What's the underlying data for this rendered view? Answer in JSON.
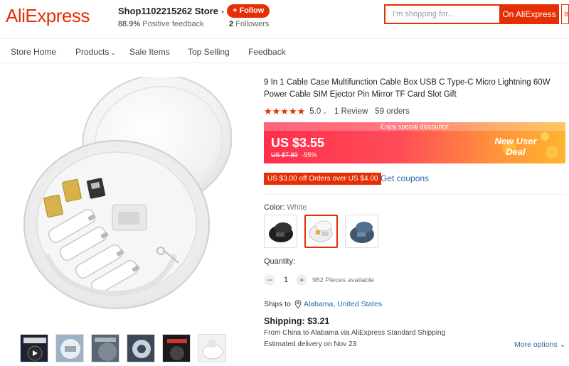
{
  "header": {
    "logo": "AliExpress",
    "store_name": "Shop1102215262 Store",
    "store_caret": "▾",
    "feedback_pct": "88.9%",
    "feedback_label": "Positive feedback",
    "follow_label": "+ Follow",
    "followers_count": "2",
    "followers_label": "Followers",
    "search_placeholder": "I'm shopping for...",
    "search_button": "On AliExpress",
    "search_right": "In"
  },
  "nav": {
    "items": [
      {
        "label": "Store Home"
      },
      {
        "label": "Products",
        "caret": "⌄"
      },
      {
        "label": "Sale Items"
      },
      {
        "label": "Top Selling"
      },
      {
        "label": "Feedback"
      }
    ]
  },
  "product": {
    "title": "9 In 1 Cable Case Multifunction Cable Box USB C Type-C Micro Lightning 60W Power Cable SIM Ejector Pin Mirror TF Card Slot Gift",
    "stars": "★★★★★",
    "rating": "5.0",
    "rating_caret": "⌄",
    "reviews": "1 Review",
    "orders": "59 orders"
  },
  "price": {
    "banner_text": "Enjoy special discounts!",
    "current": "US $3.55",
    "original": "US $7.89",
    "discount": "-55%",
    "new_user": "New User Deal",
    "coupon_tag": "US $3.00 off Orders over US $4.00",
    "coupon_link": "Get coupons"
  },
  "color": {
    "label": "Color:",
    "selected": "White",
    "options": [
      "Black",
      "White",
      "Blue"
    ],
    "selected_index": 1
  },
  "quantity": {
    "label": "Quantity:",
    "minus": "−",
    "plus": "+",
    "value": "1",
    "available": "982 Pieces available"
  },
  "shipping": {
    "ships_to_label": "Ships to",
    "ships_to_location": "Alabama, United States",
    "title": "Shipping: $3.21",
    "from_line": "From China to Alabama via AliExpress Standard Shipping",
    "delivery_line": "Estimated delivery on Nov 23",
    "more_options": "More options ⌄"
  },
  "colors": {
    "brand": "#e62e04",
    "link": "#2b6aa5"
  }
}
